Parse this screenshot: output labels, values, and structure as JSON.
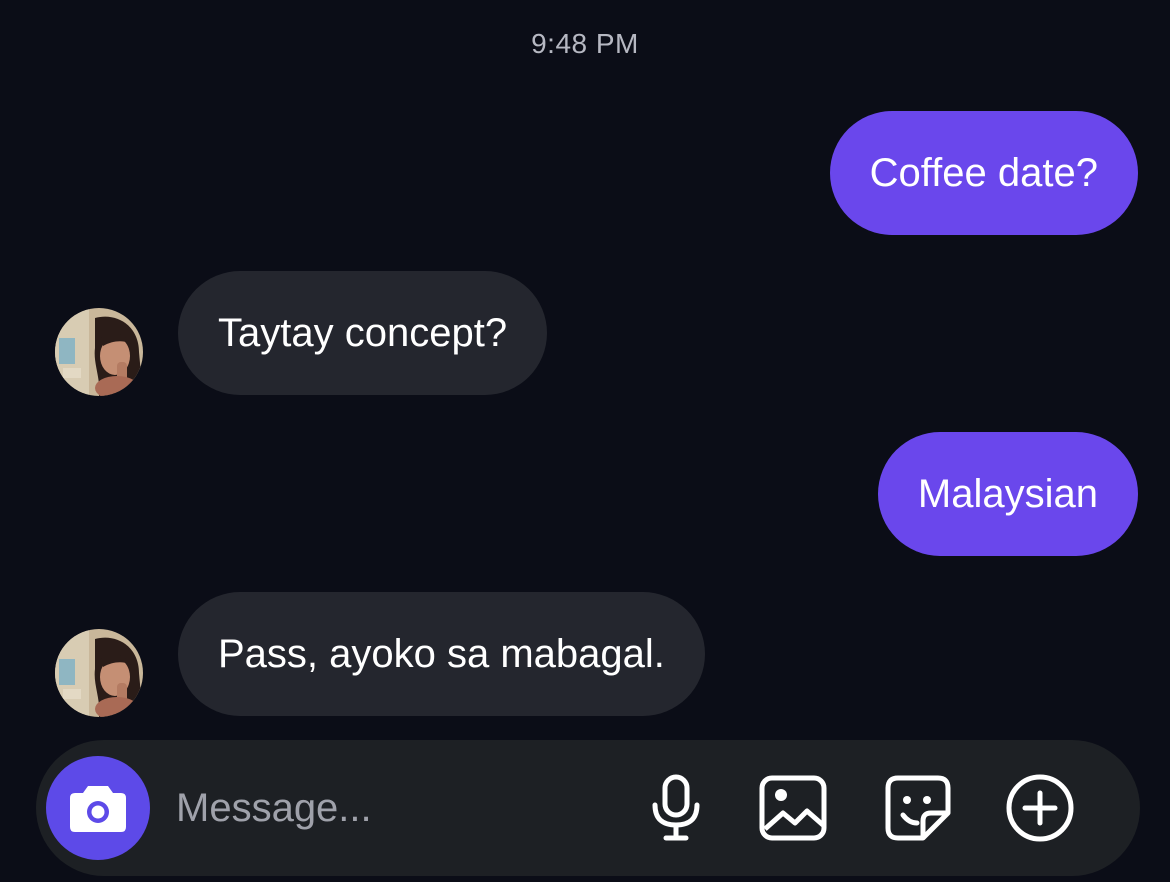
{
  "status": {
    "timestamp": "9:48 PM"
  },
  "messages": [
    {
      "sender": "me",
      "text": "Coffee date?"
    },
    {
      "sender": "them",
      "text": "Taytay concept?"
    },
    {
      "sender": "me",
      "text": "Malaysian"
    },
    {
      "sender": "them",
      "text": "Pass, ayoko sa mabagal."
    }
  ],
  "composer": {
    "placeholder": "Message...",
    "value": "",
    "icons": [
      "camera-icon",
      "microphone-icon",
      "gallery-icon",
      "sticker-icon",
      "add-icon"
    ]
  },
  "colors": {
    "background": "#0b0d17",
    "sent_bubble": "#6a47ec",
    "received_bubble": "#24262e",
    "camera_button": "#5d4ae8",
    "composer_bar": "#1d2024"
  }
}
